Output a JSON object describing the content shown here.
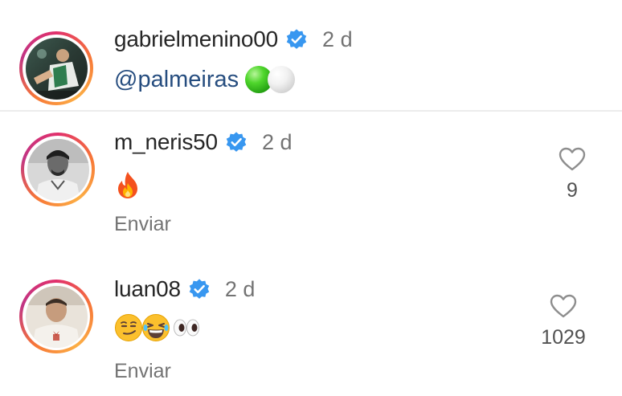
{
  "comments": [
    {
      "username": "gabrielmenino00",
      "verified": true,
      "time": "2 d",
      "text": "@palmeiras",
      "emojis": [
        "green-ball-emoji",
        "white-ball-emoji"
      ],
      "avatar": "soccer-player-avatar"
    },
    {
      "username": "m_neris50",
      "verified": true,
      "time": "2 d",
      "emojis": [
        "fire-emoji"
      ],
      "send_label": "Enviar",
      "likes": "9",
      "avatar": "bw-portrait-avatar"
    },
    {
      "username": "luan08",
      "verified": true,
      "time": "2 d",
      "emojis": [
        "smirking-face-emoji",
        "laughing-face-emoji",
        "eyes-emoji"
      ],
      "send_label": "Enviar",
      "likes": "1029",
      "avatar": "portrait-avatar"
    }
  ],
  "colors": {
    "verified_blue": "#3897f0",
    "mention_blue": "#264d7f",
    "text_primary": "#262626",
    "text_secondary": "#737373"
  }
}
